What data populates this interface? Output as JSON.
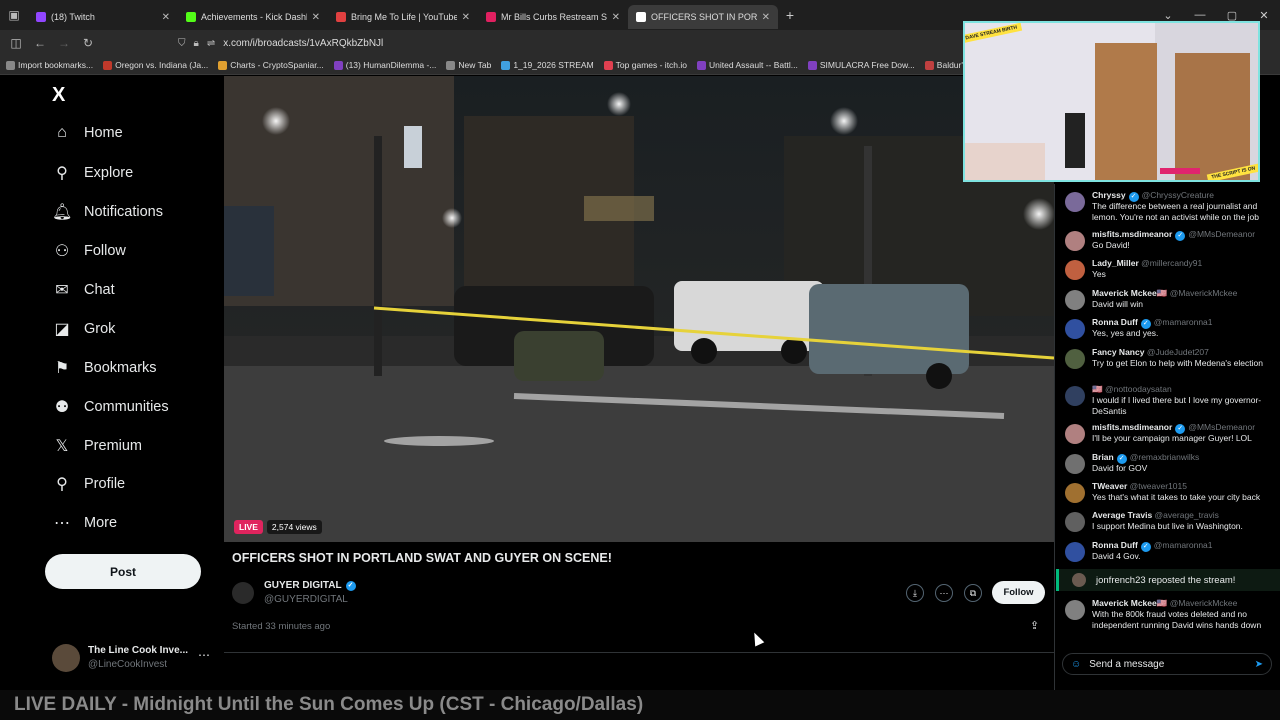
{
  "browser": {
    "tabs": [
      {
        "label": "(18) Twitch",
        "color": "#9146ff",
        "active": false
      },
      {
        "label": "Achievements - Kick Dashboard",
        "color": "#53fc18",
        "active": false
      },
      {
        "label": "Bring Me To Life | YouTube",
        "color": "#e04040",
        "active": false
      },
      {
        "label": "Mr Bills Curbs Restream Show/",
        "color": "#e02060",
        "active": false
      },
      {
        "label": "OFFICERS SHOT IN PORTLA",
        "color": "#ffffff",
        "active": true
      }
    ],
    "url": "x.com/i/broadcasts/1vAxRQkbZbNJl",
    "bookmarks": [
      {
        "label": "Import bookmarks...",
        "color": "#888888"
      },
      {
        "label": "Oregon vs. Indiana (Ja...",
        "color": "#c0392b"
      },
      {
        "label": "Charts - CryptoSpaniar...",
        "color": "#e0a030"
      },
      {
        "label": "(13) HumanDilemma -...",
        "color": "#8040c0"
      },
      {
        "label": "New Tab",
        "color": "#888888"
      },
      {
        "label": "1_19_2026 STREAM",
        "color": "#40a0e0"
      },
      {
        "label": "Top games - itch.io",
        "color": "#e04050"
      },
      {
        "label": "United Assault -- Battl...",
        "color": "#8040c0"
      },
      {
        "label": "SIMULACRA Free Dow...",
        "color": "#8040c0"
      },
      {
        "label": "Baldur's Gate II: Enhan...",
        "color": "#c04040"
      }
    ]
  },
  "sidebar": {
    "logo": "X",
    "items": [
      {
        "label": "Home",
        "icon": "home-icon",
        "glyph": "⌂"
      },
      {
        "label": "Explore",
        "icon": "search-icon",
        "glyph": "⚲"
      },
      {
        "label": "Notifications",
        "icon": "bell-icon",
        "glyph": "🔔︎"
      },
      {
        "label": "Follow",
        "icon": "add-person-icon",
        "glyph": "⚇"
      },
      {
        "label": "Chat",
        "icon": "mail-icon",
        "glyph": "✉"
      },
      {
        "label": "Grok",
        "icon": "grok-icon",
        "glyph": "◪"
      },
      {
        "label": "Bookmarks",
        "icon": "bookmark-icon",
        "glyph": "⚑"
      },
      {
        "label": "Communities",
        "icon": "communities-icon",
        "glyph": "⚉"
      },
      {
        "label": "Premium",
        "icon": "x-premium-icon",
        "glyph": "𝕏"
      },
      {
        "label": "Profile",
        "icon": "profile-icon",
        "glyph": "⚲"
      },
      {
        "label": "More",
        "icon": "more-circle-icon",
        "glyph": "⋯"
      }
    ],
    "post_label": "Post",
    "account": {
      "name": "The Line Cook Inve...",
      "handle": "@LineCookInvest"
    }
  },
  "broadcast": {
    "live_label": "LIVE",
    "views": "2,574 views",
    "title": "OFFICERS SHOT IN PORTLAND SWAT AND GUYER ON SCENE!",
    "host_name": "GUYER DIGITAL",
    "host_handle": "@GUYERDIGITAL",
    "follow_label": "Follow",
    "started": "Started 33 minutes ago"
  },
  "chat": {
    "messages": [
      {
        "name": "Chryssy",
        "verified": true,
        "handle": "@ChryssyCreature",
        "text": "The difference between a real journalist and lemon. You're not an activist while on the job",
        "color": "#7a6a9a"
      },
      {
        "name": "misfits.msdimeanor",
        "verified": true,
        "handle": "@MMsDemeanor",
        "text": "Go David!",
        "color": "#b08080"
      },
      {
        "name": "Lady_Miller",
        "verified": false,
        "handle": "@millercandy91",
        "text": "Yes",
        "color": "#c06040"
      },
      {
        "name": "Maverick Mckee🇺🇸",
        "verified": false,
        "handle": "@MaverickMckee",
        "text": "David will win",
        "color": "#808080"
      },
      {
        "name": "Ronna Duff",
        "verified": true,
        "handle": "@mamaronna1",
        "text": "Yes, yes and yes.",
        "color": "#3050a0"
      },
      {
        "name": "Fancy Nancy",
        "verified": false,
        "handle": "@JudeJudet207",
        "text": "Try to get Elon to help with Medena's election",
        "color": "#506040"
      },
      {
        "name": "🇺🇸",
        "verified": false,
        "handle": "@nottoodaysatan",
        "text": "I would if I lived there but I love my governor- DeSantis",
        "color": "#304060"
      },
      {
        "name": "misfits.msdimeanor",
        "verified": true,
        "handle": "@MMsDemeanor",
        "text": "I'll be your campaign manager Guyer! LOL",
        "color": "#b08080"
      },
      {
        "name": "Brian",
        "verified": true,
        "handle": "@remaxbrianwilks",
        "text": "David for GOV",
        "color": "#707070"
      },
      {
        "name": "TWeaver",
        "verified": false,
        "handle": "@tweaver1015",
        "text": "Yes that's what it takes to take your city back",
        "color": "#a07030"
      },
      {
        "name": "Average Travis",
        "verified": false,
        "handle": "@average_travis",
        "text": "I support Medina but live in Washington.",
        "color": "#606060"
      },
      {
        "name": "Ronna Duff",
        "verified": true,
        "handle": "@mamaronna1",
        "text": "David 4 Gov.",
        "color": "#3050a0"
      }
    ],
    "repost": "jonfrench23 reposted the stream!",
    "last_message": {
      "name": "Maverick Mckee🇺🇸",
      "handle": "@MaverickMckee",
      "text": "With the 800k fraud votes deleted and no independent running David wins hands down",
      "color": "#808080"
    },
    "input_placeholder": "Send a message"
  },
  "webcam": {
    "tag_top": "DAVE STREAM BIRTH",
    "tag_bottom": "THE SCRIPT IS ON"
  },
  "banner": "LIVE DAILY - Midnight Until the Sun Comes Up (CST - Chicago/Dallas)"
}
